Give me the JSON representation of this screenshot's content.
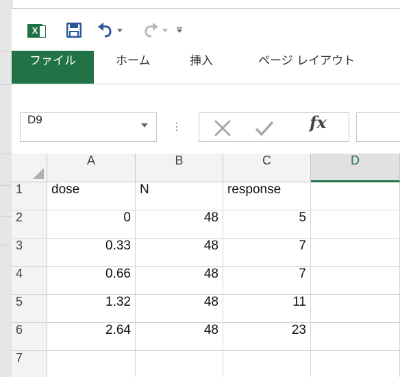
{
  "qat": {
    "excel_icon": "excel-icon",
    "save_icon": "save-icon",
    "undo_icon": "undo-icon",
    "redo_icon": "redo-icon",
    "customize_icon": "customize-icon"
  },
  "tabs": [
    {
      "label": "ファイル"
    },
    {
      "label": "ホーム"
    },
    {
      "label": "挿入"
    },
    {
      "label": "ページ レイアウト"
    }
  ],
  "formula_bar": {
    "name_box": "D9",
    "cancel_icon": "cancel-icon",
    "enter_icon": "enter-icon",
    "fx_label": "fx",
    "formula": ""
  },
  "grid": {
    "columns": [
      "A",
      "B",
      "C",
      "D"
    ],
    "active_column": "D",
    "rows": [
      "1",
      "2",
      "3",
      "4",
      "5",
      "6",
      "7"
    ],
    "cells": [
      [
        "dose",
        "N",
        "response",
        ""
      ],
      [
        "0",
        "48",
        "5",
        ""
      ],
      [
        "0.33",
        "48",
        "7",
        ""
      ],
      [
        "0.66",
        "48",
        "7",
        ""
      ],
      [
        "1.32",
        "48",
        "11",
        ""
      ],
      [
        "2.64",
        "48",
        "23",
        ""
      ],
      [
        "",
        "",
        "",
        ""
      ]
    ]
  },
  "colors": {
    "accent": "#217346",
    "save_blue": "#2b579a"
  }
}
